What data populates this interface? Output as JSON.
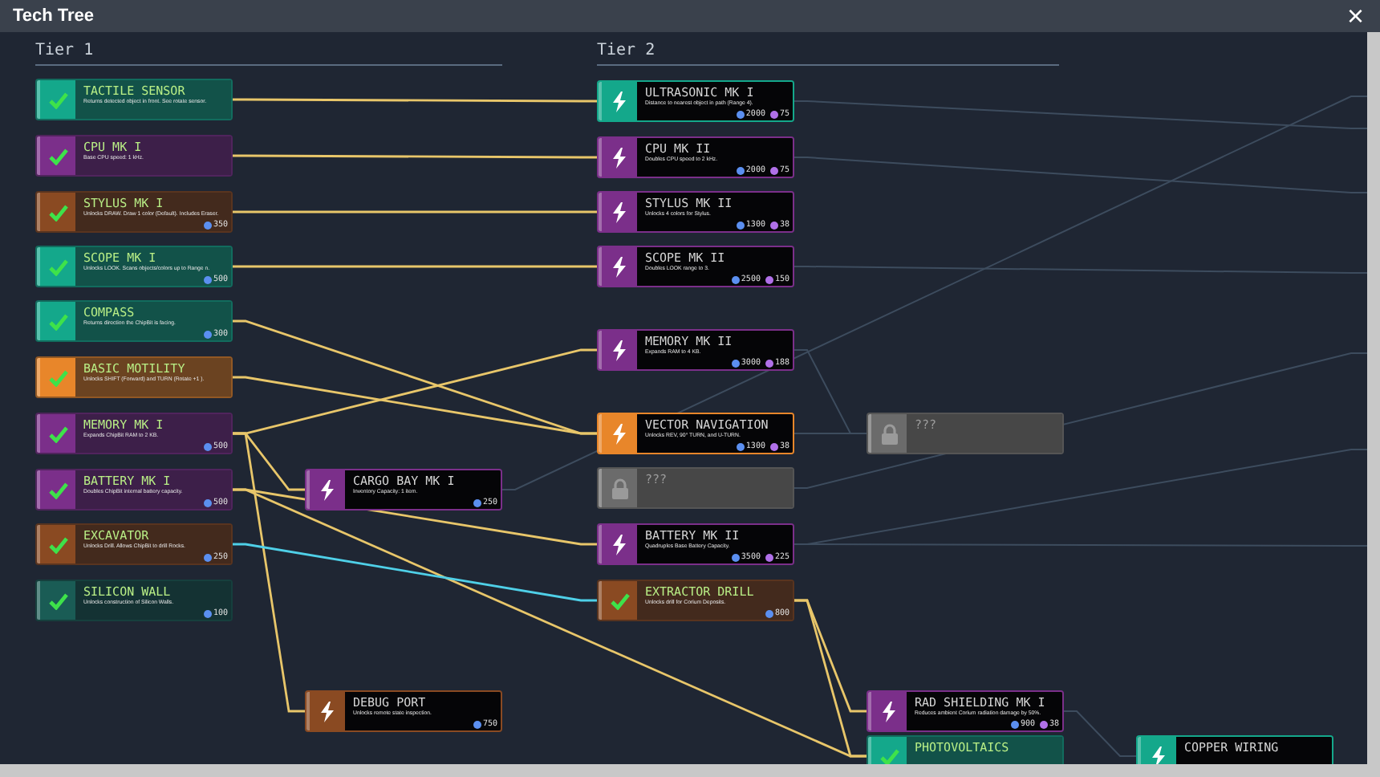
{
  "window": {
    "title": "Tech Tree",
    "close": "×"
  },
  "tiers": [
    {
      "label": "Tier 1"
    },
    {
      "label": "Tier 2"
    }
  ],
  "nodes": [
    {
      "title": "TACTILE SENSOR",
      "description": "Returns detected object in front. See rotate sensor.",
      "unlocked": true,
      "locked": false,
      "color": "#14a88b"
    },
    {
      "title": "CPU MK I",
      "description": "Base CPU speed: 1 kHz.",
      "unlocked": true,
      "locked": false,
      "color": "#7b2f8a"
    },
    {
      "title": "STYLUS MK I",
      "description": "Unlocks DRAW. Draw 1 color (Default). Includes Eraser.",
      "unlocked": true,
      "locked": false,
      "color": "#8a4a22",
      "costs": [
        {
          "kind": "core",
          "amount": "350"
        }
      ]
    },
    {
      "title": "SCOPE MK I",
      "description": "Unlocks LOOK. Scans objects/colors up to Range n.",
      "unlocked": true,
      "locked": false,
      "color": "#14a88b",
      "costs": [
        {
          "kind": "core",
          "amount": "500"
        }
      ]
    },
    {
      "title": "COMPASS",
      "description": "Returns direction the ChipBit is facing.",
      "unlocked": true,
      "locked": false,
      "color": "#14a88b",
      "costs": [
        {
          "kind": "core",
          "amount": "300"
        }
      ]
    },
    {
      "title": "BASIC MOTILITY",
      "description": "Unlocks SHIFT (Forward) and TURN (Rotate +1 ).",
      "unlocked": true,
      "locked": false,
      "color": "#e8862a"
    },
    {
      "title": "MEMORY MK I",
      "description": "Expands ChipBit RAM to 2 KB.",
      "unlocked": true,
      "locked": false,
      "color": "#7b2f8a",
      "costs": [
        {
          "kind": "core",
          "amount": "500"
        }
      ]
    },
    {
      "title": "BATTERY MK I",
      "description": "Doubles ChipBit internal battery capacity.",
      "unlocked": true,
      "locked": false,
      "color": "#7b2f8a",
      "costs": [
        {
          "kind": "core",
          "amount": "500"
        }
      ]
    },
    {
      "title": "EXCAVATOR",
      "description": "Unlocks Drill. Allows ChipBit to drill Rocks.",
      "unlocked": true,
      "locked": false,
      "color": "#8a4a22",
      "costs": [
        {
          "kind": "core",
          "amount": "250"
        }
      ]
    },
    {
      "title": "SILICON WALL",
      "description": "Unlocks construction of Silicon Walls.",
      "unlocked": true,
      "locked": false,
      "color": "#1a5c55",
      "costs": [
        {
          "kind": "core",
          "amount": "100"
        }
      ]
    },
    {
      "title": "CARGO BAY MK I",
      "description": "Inventory Capacity: 1 item.",
      "unlocked": false,
      "locked": false,
      "color": "#7b2f8a",
      "costs": [
        {
          "kind": "core",
          "amount": "250"
        }
      ]
    },
    {
      "title": "DEBUG PORT",
      "description": "Unlocks remote state inspection.",
      "unlocked": false,
      "locked": false,
      "color": "#8a4a22",
      "costs": [
        {
          "kind": "core",
          "amount": "750"
        }
      ]
    },
    {
      "title": "ULTRASONIC MK I",
      "description": "Distance to nearest object in path (Range 4).",
      "unlocked": false,
      "locked": false,
      "color": "#14a88b",
      "costs": [
        {
          "kind": "core",
          "amount": "2000"
        },
        {
          "kind": "crystal",
          "amount": "75"
        }
      ]
    },
    {
      "title": "CPU MK II",
      "description": "Doubles CPU speed to 2 kHz.",
      "unlocked": false,
      "locked": false,
      "color": "#7b2f8a",
      "costs": [
        {
          "kind": "core",
          "amount": "2000"
        },
        {
          "kind": "crystal",
          "amount": "75"
        }
      ]
    },
    {
      "title": "STYLUS MK II",
      "description": "Unlocks 4 colors for Stylus.",
      "unlocked": false,
      "locked": false,
      "color": "#7b2f8a",
      "costs": [
        {
          "kind": "core",
          "amount": "1300"
        },
        {
          "kind": "crystal",
          "amount": "38"
        }
      ]
    },
    {
      "title": "SCOPE MK II",
      "description": "Doubles LOOK range to 3.",
      "unlocked": false,
      "locked": false,
      "color": "#7b2f8a",
      "costs": [
        {
          "kind": "core",
          "amount": "2500"
        },
        {
          "kind": "crystal",
          "amount": "150"
        }
      ]
    },
    {
      "title": "MEMORY MK II",
      "description": "Expands RAM to 4 KB.",
      "unlocked": false,
      "locked": false,
      "color": "#7b2f8a",
      "costs": [
        {
          "kind": "core",
          "amount": "3000"
        },
        {
          "kind": "crystal",
          "amount": "188"
        }
      ]
    },
    {
      "title": "VECTOR NAVIGATION",
      "description": "Unlocks REV, 90° TURN, and U-TURN.",
      "unlocked": false,
      "locked": false,
      "color": "#e8862a",
      "costs": [
        {
          "kind": "core",
          "amount": "1300"
        },
        {
          "kind": "crystal",
          "amount": "38"
        }
      ]
    },
    {
      "title": "???",
      "unlocked": false,
      "locked": true,
      "color": "#6b6b6b"
    },
    {
      "title": "BATTERY MK II",
      "description": "Quadruples Base Battery Capacity.",
      "unlocked": false,
      "locked": false,
      "color": "#7b2f8a",
      "costs": [
        {
          "kind": "core",
          "amount": "3500"
        },
        {
          "kind": "crystal",
          "amount": "225"
        }
      ]
    },
    {
      "title": "EXTRACTOR DRILL",
      "description": "Unlocks drill for Corium Deposits.",
      "unlocked": true,
      "locked": false,
      "color": "#8a4a22",
      "costs": [
        {
          "kind": "core",
          "amount": "800"
        }
      ]
    },
    {
      "title": "???",
      "unlocked": false,
      "locked": true,
      "color": "#6b6b6b"
    },
    {
      "title": "RAD SHIELDING MK I",
      "description": "Reduces ambient Corium radiation damage by 50%.",
      "unlocked": false,
      "locked": false,
      "color": "#7b2f8a",
      "costs": [
        {
          "kind": "core",
          "amount": "900"
        },
        {
          "kind": "crystal",
          "amount": "38"
        }
      ]
    },
    {
      "title": "PHOTOVOLTAICS",
      "unlocked": true,
      "locked": false,
      "color": "#14a88b"
    },
    {
      "title": "COPPER WIRING",
      "unlocked": false,
      "locked": false,
      "color": "#14a88b"
    }
  ]
}
